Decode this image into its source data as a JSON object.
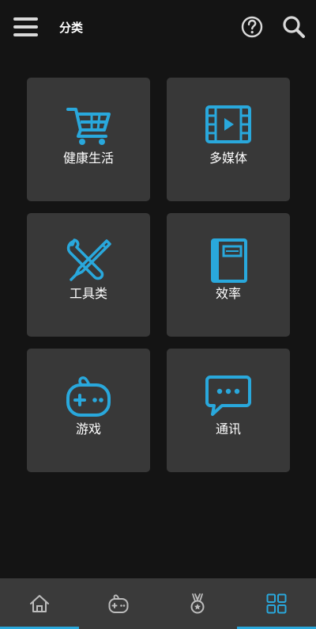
{
  "header": {
    "title": "分类",
    "menu_icon": "hamburger-menu-icon",
    "help_icon": "question-circle-icon",
    "search_icon": "search-icon"
  },
  "categories": [
    {
      "label": "健康生活",
      "icon": "shopping-cart-icon"
    },
    {
      "label": "多媒体",
      "icon": "video-play-icon"
    },
    {
      "label": "工具类",
      "icon": "wrench-pen-icon"
    },
    {
      "label": "效率",
      "icon": "notebook-icon"
    },
    {
      "label": "游戏",
      "icon": "gamepad-icon"
    },
    {
      "label": "通讯",
      "icon": "chat-bubble-icon"
    }
  ],
  "tabs": [
    {
      "icon": "home-icon",
      "active": false
    },
    {
      "icon": "gamepad-icon",
      "active": false
    },
    {
      "icon": "medal-icon",
      "active": false
    },
    {
      "icon": "grid-icon",
      "active": true
    }
  ],
  "colors": {
    "background": "#141414",
    "tile": "#383838",
    "accent": "#29a8dc",
    "tabbar": "#3a3a3a",
    "inactive_icon": "#bdbdbd"
  }
}
